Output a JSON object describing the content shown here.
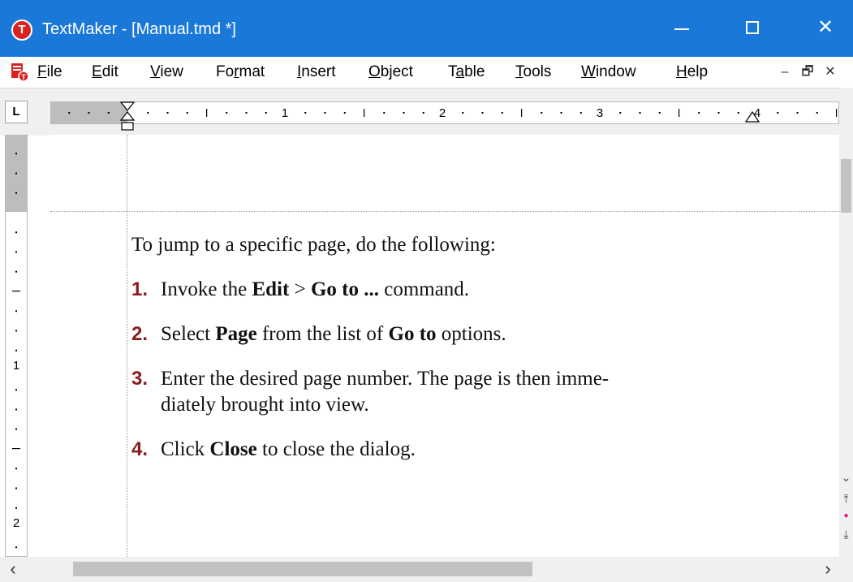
{
  "window": {
    "app_icon_letter": "T",
    "title": "TextMaker - [Manual.tmd *]",
    "close_glyph": "✕"
  },
  "menubar": {
    "items": [
      {
        "pre": "",
        "u": "F",
        "post": "ile"
      },
      {
        "pre": "",
        "u": "E",
        "post": "dit"
      },
      {
        "pre": "",
        "u": "V",
        "post": "iew"
      },
      {
        "pre": "Fo",
        "u": "r",
        "post": "mat"
      },
      {
        "pre": "",
        "u": "I",
        "post": "nsert"
      },
      {
        "pre": "",
        "u": "O",
        "post": "bject"
      },
      {
        "pre": "T",
        "u": "a",
        "post": "ble"
      },
      {
        "pre": "",
        "u": "T",
        "post": "ools"
      },
      {
        "pre": "",
        "u": "W",
        "post": "indow"
      },
      {
        "pre": "",
        "u": "H",
        "post": "elp"
      }
    ],
    "mdi_minimize": "–",
    "mdi_restore": "🗗",
    "mdi_close": "✕"
  },
  "ruler": {
    "tab_selector": "L",
    "h_labels": [
      "1",
      "2",
      "3",
      "4"
    ],
    "v_labels": [
      "1",
      "2"
    ]
  },
  "document": {
    "intro": "To jump to a specific page, do the following:",
    "steps": [
      {
        "num": "1.",
        "p1": "Invoke the ",
        "b1": "Edit",
        "p2": " > ",
        "b2": "Go to ...",
        "p3": " command."
      },
      {
        "num": "2.",
        "p1": "Select ",
        "b1": "Page",
        "p2": " from the list of ",
        "b2": "Go to",
        "p3": " options."
      },
      {
        "num": "3.",
        "line1": "Enter the desired page number. The page is then imme-",
        "line2": "diately brought into view."
      },
      {
        "num": "4.",
        "p1": "Click ",
        "b1": "Close",
        "p2": " to close the dialog."
      }
    ]
  },
  "scrollbars": {
    "h_left": "‹",
    "h_right": "›",
    "v_down": "⌄",
    "v_prev_page": "⤒",
    "v_browse": "●",
    "v_next_page": "⤓"
  },
  "colors": {
    "titlebar": "#1a78d9",
    "step_number": "#8b1a1a",
    "app_icon": "#d7231f"
  }
}
